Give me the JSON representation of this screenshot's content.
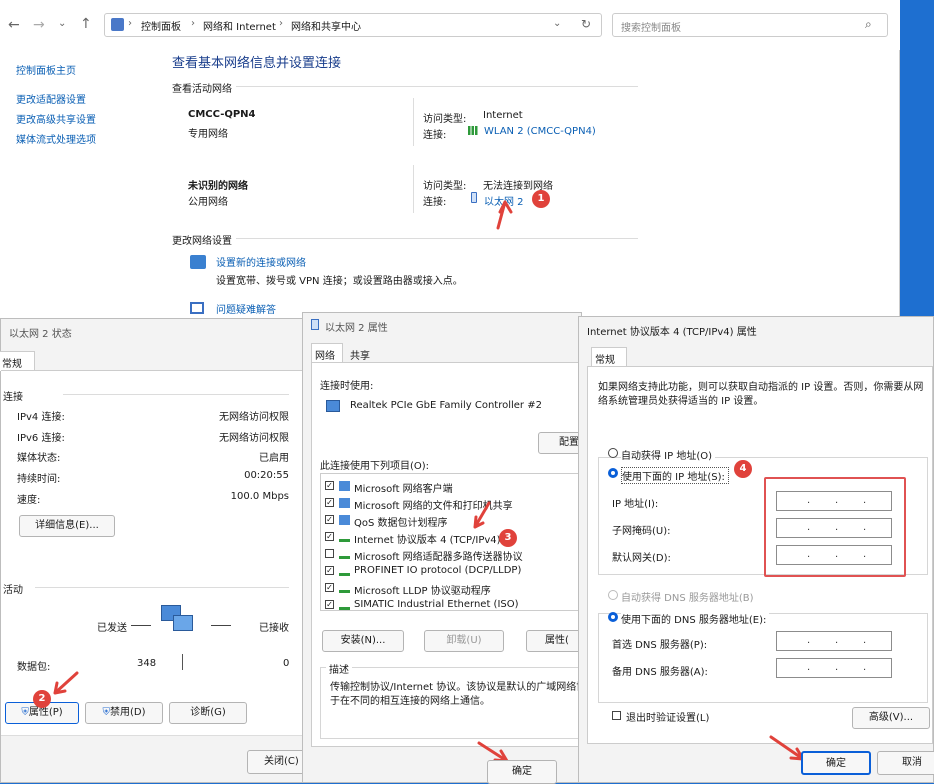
{
  "control_panel": {
    "address": {
      "icon": "control-panel-icon",
      "crumbs": [
        "控制面板",
        "网络和 Internet",
        "网络和共享中心"
      ],
      "search_placeholder": "搜索控制面板"
    },
    "sidebar": [
      "控制面板主页",
      "更改适配器设置",
      "更改高级共享设置",
      "媒体流式处理选项"
    ],
    "title": "查看基本网络信息并设置连接",
    "active_heading": "查看活动网络",
    "networks": [
      {
        "name": "CMCC-QPN4",
        "category": "专用网络",
        "access_label": "访问类型:",
        "access_value": "Internet",
        "conn_label": "连接:",
        "conn_value": "WLAN 2 (CMCC-QPN4)"
      },
      {
        "name": "未识别的网络",
        "category": "公用网络",
        "access_label": "访问类型:",
        "access_value": "无法连接到网络",
        "conn_label": "连接:",
        "conn_value": "以太网 2"
      }
    ],
    "change_heading": "更改网络设置",
    "actions": [
      {
        "link": "设置新的连接或网络",
        "desc": "设置宽带、拨号或 VPN 连接；或设置路由器或接入点。"
      },
      {
        "link": "问题疑难解答",
        "desc": ""
      }
    ]
  },
  "status_dialog": {
    "title": "以太网 2 状态",
    "tab": "常规",
    "connection_heading": "连接",
    "rows": [
      {
        "label": "IPv4 连接:",
        "value": "无网络访问权限"
      },
      {
        "label": "IPv6 连接:",
        "value": "无网络访问权限"
      },
      {
        "label": "媒体状态:",
        "value": "已启用"
      },
      {
        "label": "持续时间:",
        "value": "00:20:55"
      },
      {
        "label": "速度:",
        "value": "100.0 Mbps"
      }
    ],
    "details_button": "详细信息(E)...",
    "activity_heading": "活动",
    "sent_label": "已发送",
    "recv_label": "已接收",
    "packets_label": "数据包:",
    "packets_sent": "348",
    "packets_recv": "0",
    "buttons": {
      "properties": "属性(P)",
      "disable": "禁用(D)",
      "diagnose": "诊断(G)",
      "close": "关闭(C)"
    }
  },
  "props_dialog": {
    "title": "以太网 2 属性",
    "tabs": [
      "网络",
      "共享"
    ],
    "connect_using_label": "连接时使用:",
    "adapter": "Realtek PCIe GbE Family Controller #2",
    "configure_button": "配置(",
    "items_label": "此连接使用下列项目(O):",
    "items": [
      {
        "checked": true,
        "label": "Microsoft 网络客户端"
      },
      {
        "checked": true,
        "label": "Microsoft 网络的文件和打印机共享"
      },
      {
        "checked": true,
        "label": "QoS 数据包计划程序"
      },
      {
        "checked": true,
        "label": "Internet 协议版本 4 (TCP/IPv4)"
      },
      {
        "checked": false,
        "label": "Microsoft 网络适配器多路传送器协议"
      },
      {
        "checked": true,
        "label": "PROFINET IO protocol (DCP/LLDP)"
      },
      {
        "checked": true,
        "label": "Microsoft LLDP 协议驱动程序"
      },
      {
        "checked": true,
        "label": "SIMATIC Industrial Ethernet (ISO)"
      }
    ],
    "install_button": "安装(N)...",
    "uninstall_button": "卸载(U)",
    "properties_button": "属性(",
    "description_heading": "描述",
    "description": "传输控制协议/Internet 协议。该协议是默认的广域网络协\n于在不同的相互连接的网络上通信。",
    "ok_button": "确定"
  },
  "ipv4_dialog": {
    "title": "Internet 协议版本 4 (TCP/IPv4) 属性",
    "tab": "常规",
    "intro": "如果网络支持此功能，则可以获取自动指派的 IP 设置。否则，你需要从网\n络系统管理员处获得适当的 IP 设置。",
    "auto_ip": "自动获得 IP 地址(O)",
    "use_ip": "使用下面的 IP 地址(S):",
    "ip_label": "IP 地址(I):",
    "mask_label": "子网掩码(U):",
    "gateway_label": "默认网关(D):",
    "auto_dns": "自动获得 DNS 服务器地址(B)",
    "use_dns": "使用下面的 DNS 服务器地址(E):",
    "dns1_label": "首选 DNS 服务器(P):",
    "dns2_label": "备用 DNS 服务器(A):",
    "validate": "退出时验证设置(L)",
    "advanced_button": "高级(V)...",
    "ok_button": "确定",
    "cancel_button": "取消"
  },
  "annotations": [
    "1",
    "2",
    "3",
    "4"
  ],
  "colors": {
    "accent": "#0a5fb4",
    "badge": "#e0423b",
    "highlight_box": "#e05252"
  }
}
